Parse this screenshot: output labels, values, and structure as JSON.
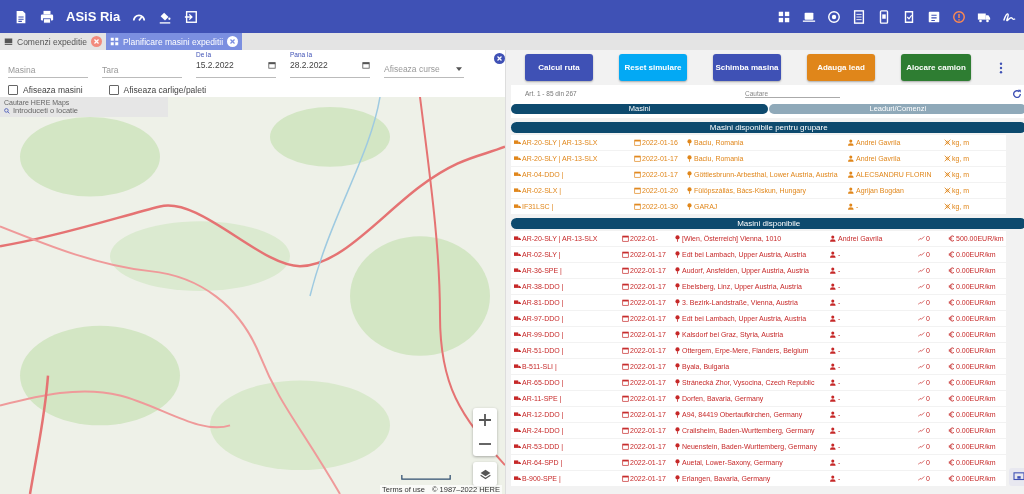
{
  "header": {
    "title": "ASiS Ria"
  },
  "tabs": [
    {
      "label": "Comenzi expeditie",
      "selected": false
    },
    {
      "label": "Planificare masini expeditii",
      "selected": true
    }
  ],
  "filters": [
    {
      "kind": "text",
      "placeholder": "Masina"
    },
    {
      "kind": "text",
      "placeholder": "Tara"
    },
    {
      "kind": "date",
      "label": "De la",
      "value": "15.2.2022"
    },
    {
      "kind": "date",
      "label": "Pana la",
      "value": "28.2.2022"
    },
    {
      "kind": "select",
      "placeholder": "Afiseaza curse"
    }
  ],
  "checkboxes": [
    {
      "label": "Afiseaza masini",
      "checked": false
    },
    {
      "label": "Afiseaza carlige/paleti",
      "checked": false
    }
  ],
  "map": {
    "search_label": "Cautare HERE Maps",
    "search_placeholder": "Introduceti o locatie",
    "terms": "Terms of use",
    "copyright": "© 1987–2022 HERE"
  },
  "actions": [
    {
      "label": "Calcul ruta",
      "color": "#3f51b5"
    },
    {
      "label": "Reset simulare",
      "color": "#03a9f4"
    },
    {
      "label": "Schimba masina",
      "color": "#3f51b5"
    },
    {
      "label": "Adauga lead",
      "color": "#e0861a"
    },
    {
      "label": "Alocare camion",
      "color": "#2e7d32"
    }
  ],
  "list": {
    "range": "Art. 1 - 85 din 267",
    "search_placeholder": "Cautare",
    "tabs": [
      {
        "label": "Masini",
        "selected": true
      },
      {
        "label": "Leaduri/Comenzi",
        "selected": false
      }
    ],
    "groups": [
      {
        "title": "Masini disponibile pentru grupare",
        "kind": "grouping",
        "rows": [
          {
            "vehicle": "AR-20-SLY | AR-13-SLX",
            "date": "2022-01-16",
            "location": "Baciu, Romania",
            "driver": "Andrei Gavrila",
            "capacity": "kg, m"
          },
          {
            "vehicle": "AR-20-SLY | AR-13-SLX",
            "date": "2022-01-17",
            "location": "Baciu, Romania",
            "driver": "Andrei Gavrila",
            "capacity": "kg, m"
          },
          {
            "vehicle": "AR-04-DDO |",
            "date": "2022-01-17",
            "location": "Göttlesbrunn-Arbesthal, Lower Austria, Austria",
            "driver": "ALECSANDRU FLORIN",
            "capacity": "kg, m"
          },
          {
            "vehicle": "AR-02-SLX |",
            "date": "2022-01-20",
            "location": "Fülöpszállás, Bács-Kiskun, Hungary",
            "driver": "Agrijan Bogdan",
            "capacity": "kg, m"
          },
          {
            "vehicle": "IF31LSC |",
            "date": "2022-01-30",
            "location": "GARAJ",
            "driver": "-",
            "capacity": "kg, m"
          }
        ]
      },
      {
        "title": "Masini disponibile",
        "kind": "available",
        "rows": [
          {
            "vehicle": "AR-20-SLY | AR-13-SLX",
            "date": "2022-01-",
            "location": "[Wien, Österreich] Vienna, 1010",
            "driver": "Andrei Gavrila",
            "km": "0",
            "price": "500.00EUR/km"
          },
          {
            "vehicle": "AR-02-SLY |",
            "date": "2022-01-17",
            "location": "Edt bei Lambach, Upper Austria, Austria",
            "driver": "-",
            "km": "0",
            "price": "0.00EUR/km"
          },
          {
            "vehicle": "AR-36-SPE |",
            "date": "2022-01-17",
            "location": "Audorf, Ansfelden, Upper Austria, Austria",
            "driver": "-",
            "km": "0",
            "price": "0.00EUR/km"
          },
          {
            "vehicle": "AR-38-DDO |",
            "date": "2022-01-17",
            "location": "Ebelsberg, Linz, Upper Austria, Austria",
            "driver": "-",
            "km": "0",
            "price": "0.00EUR/km"
          },
          {
            "vehicle": "AR-81-DDO |",
            "date": "2022-01-17",
            "location": "3. Bezirk-Landstraße, Vienna, Austria",
            "driver": "-",
            "km": "0",
            "price": "0.00EUR/km"
          },
          {
            "vehicle": "AR-97-DDO |",
            "date": "2022-01-17",
            "location": "Edt bei Lambach, Upper Austria, Austria",
            "driver": "-",
            "km": "0",
            "price": "0.00EUR/km"
          },
          {
            "vehicle": "AR-99-DDO |",
            "date": "2022-01-17",
            "location": "Kalsdorf bei Graz, Styria, Austria",
            "driver": "-",
            "km": "0",
            "price": "0.00EUR/km"
          },
          {
            "vehicle": "AR-51-DDO |",
            "date": "2022-01-17",
            "location": "Ottergem, Erpe-Mere, Flanders, Belgium",
            "driver": "-",
            "km": "0",
            "price": "0.00EUR/km"
          },
          {
            "vehicle": "B-511-SLI |",
            "date": "2022-01-17",
            "location": "Byala, Bulgaria",
            "driver": "-",
            "km": "0",
            "price": "0.00EUR/km"
          },
          {
            "vehicle": "AR-65-DDO |",
            "date": "2022-01-17",
            "location": "Stránecká Zhor, Vysocina, Czech Republic",
            "driver": "-",
            "km": "0",
            "price": "0.00EUR/km"
          },
          {
            "vehicle": "AR-11-SPE |",
            "date": "2022-01-17",
            "location": "Dorfen, Bavaria, Germany",
            "driver": "-",
            "km": "0",
            "price": "0.00EUR/km"
          },
          {
            "vehicle": "AR-12-DDO |",
            "date": "2022-01-17",
            "location": "A94, 84419 Obertaufkirchen, Germany",
            "driver": "-",
            "km": "0",
            "price": "0.00EUR/km"
          },
          {
            "vehicle": "AR-24-DDO |",
            "date": "2022-01-17",
            "location": "Crailsheim, Baden-Wurttemberg, Germany",
            "driver": "-",
            "km": "0",
            "price": "0.00EUR/km"
          },
          {
            "vehicle": "AR-53-DDD |",
            "date": "2022-01-17",
            "location": "Neuenstein, Baden-Wurttemberg, Germany",
            "driver": "-",
            "km": "0",
            "price": "0.00EUR/km"
          },
          {
            "vehicle": "AR-64-SPD |",
            "date": "2022-01-17",
            "location": "Auetal, Lower-Saxony, Germany",
            "driver": "-",
            "km": "0",
            "price": "0.00EUR/km"
          },
          {
            "vehicle": "B-900-SPE |",
            "date": "2022-01-17",
            "location": "Erlangen, Bavaria, Germany",
            "driver": "-",
            "km": "0",
            "price": "0.00EUR/km"
          }
        ]
      }
    ]
  }
}
